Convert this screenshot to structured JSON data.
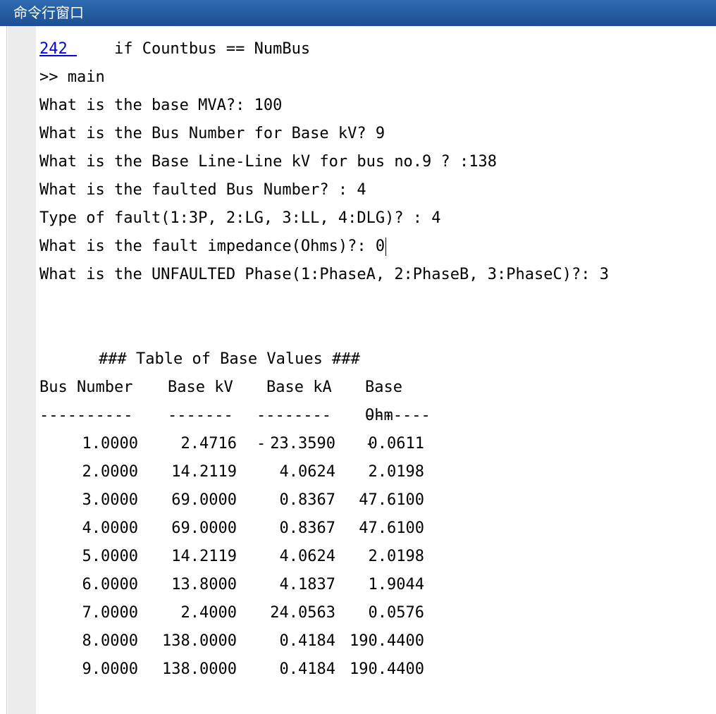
{
  "window": {
    "title": "命令行窗口"
  },
  "console": {
    "prev_link": "242 ",
    "prev_code": "    if Countbus == NumBus",
    "prompt": ">> ",
    "command": "main",
    "lines": [
      "What is the base MVA?: 100",
      "What is the Bus Number for Base kV? 9",
      "What is the Base Line-Line kV for bus no.9 ? :138",
      "What is the faulted Bus Number? : 4",
      "Type of fault(1:3P, 2:LG, 3:LL, 4:DLG)? : 4"
    ],
    "impedance_line": "What is the fault impedance(Ohms)?: 0",
    "unfaulted_line": "What is the UNFAULTED Phase(1:PhaseA, 2:PhaseB, 3:PhaseC)?: 3"
  },
  "table": {
    "title": "### Table of Base Values ###",
    "headers": [
      "Bus Number",
      "Base kV",
      "Base kA",
      "Base Ohm"
    ],
    "separators": [
      "----------",
      "-------",
      "---------",
      "--------"
    ],
    "rows": [
      [
        "1.0000",
        "2.4716",
        "23.3590",
        "0.0611"
      ],
      [
        "2.0000",
        "14.2119",
        "4.0624",
        "2.0198"
      ],
      [
        "3.0000",
        "69.0000",
        "0.8367",
        "47.6100"
      ],
      [
        "4.0000",
        "69.0000",
        "0.8367",
        "47.6100"
      ],
      [
        "5.0000",
        "14.2119",
        "4.0624",
        "2.0198"
      ],
      [
        "6.0000",
        "13.8000",
        "4.1837",
        "1.9044"
      ],
      [
        "7.0000",
        "2.4000",
        "24.0563",
        "0.0576"
      ],
      [
        "8.0000",
        "138.0000",
        "0.4184",
        "190.4400"
      ],
      [
        "9.0000",
        "138.0000",
        "0.4184",
        "190.4400"
      ]
    ]
  }
}
